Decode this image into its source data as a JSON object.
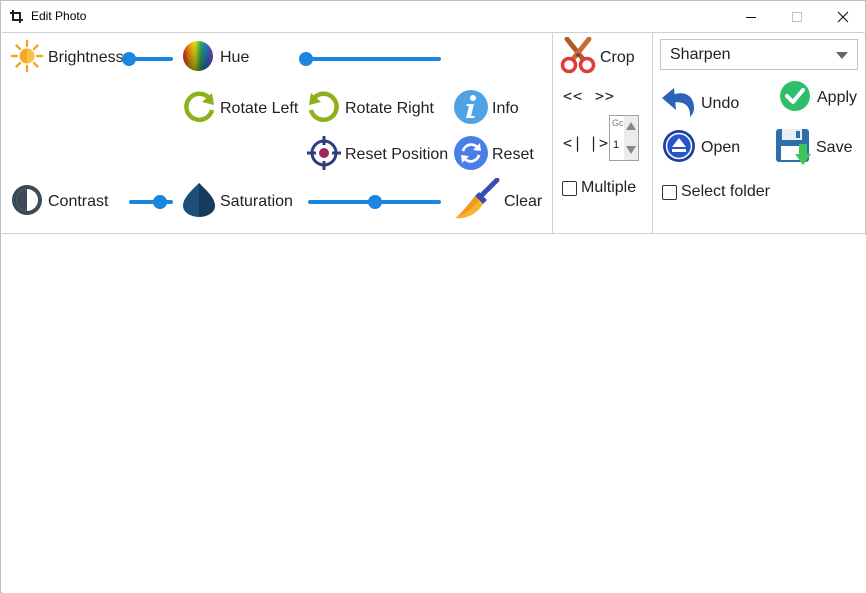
{
  "window": {
    "title": "Edit Photo",
    "controls": {
      "minimize": "minimize",
      "maximize": "maximize",
      "close": "close"
    }
  },
  "adjust": {
    "brightness": {
      "label": "Brightness",
      "icon": "sun-icon",
      "value": 0.0
    },
    "hue": {
      "label": "Hue",
      "icon": "rainbow-icon",
      "value": 0.0
    },
    "contrast": {
      "label": "Contrast",
      "icon": "contrast-icon",
      "value": 0.7
    },
    "saturation": {
      "label": "Saturation",
      "icon": "droplet-icon",
      "value": 0.5
    }
  },
  "transform": {
    "rotate_left": {
      "label": "Rotate Left",
      "icon": "rotate-left-icon"
    },
    "rotate_right": {
      "label": "Rotate Right",
      "icon": "rotate-right-icon"
    },
    "reset_position": {
      "label": "Reset Position",
      "icon": "target-icon"
    },
    "info": {
      "label": "Info",
      "icon": "info-icon"
    },
    "reset": {
      "label": "Reset",
      "icon": "refresh-icon"
    },
    "clear": {
      "label": "Clear",
      "icon": "broom-icon"
    }
  },
  "crop_panel": {
    "crop": {
      "label": "Crop",
      "icon": "scissors-icon"
    },
    "prev": "<<",
    "next": ">>",
    "first": "<|",
    "last": "|>",
    "spinner": {
      "top_text": "Gc",
      "value": "1"
    },
    "multiple": {
      "label": "Multiple",
      "checked": false
    }
  },
  "file_panel": {
    "filter": {
      "selected": "Sharpen"
    },
    "undo": {
      "label": "Undo",
      "icon": "undo-icon"
    },
    "apply": {
      "label": "Apply",
      "icon": "check-icon"
    },
    "open": {
      "label": "Open",
      "icon": "eject-icon"
    },
    "save": {
      "label": "Save",
      "icon": "floppy-icon"
    },
    "select_folder": {
      "label": "Select folder",
      "checked": false
    }
  },
  "colors": {
    "accent": "#1b86e0",
    "border": "#c8d4dc",
    "rotate_green": "#8db11b"
  }
}
